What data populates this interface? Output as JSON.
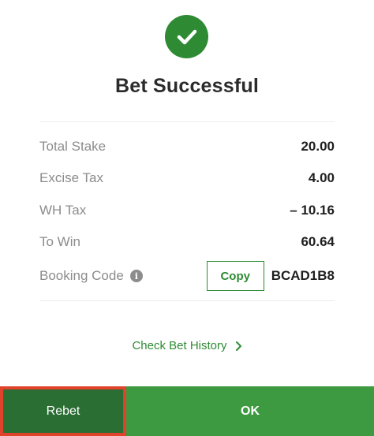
{
  "header": {
    "title": "Bet Successful",
    "icon": "checkmark-circle-icon"
  },
  "summary": {
    "total_stake_label": "Total Stake",
    "total_stake_value": "20.00",
    "excise_tax_label": "Excise Tax",
    "excise_tax_value": "4.00",
    "wh_tax_label": "WH Tax",
    "wh_tax_value": "– 10.16",
    "to_win_label": "To Win",
    "to_win_value": "60.64",
    "booking_code_label": "Booking Code",
    "booking_code_value": "BCAD1B8",
    "copy_label": "Copy",
    "info_icon": "info-icon"
  },
  "links": {
    "check_history_label": "Check Bet History",
    "chevron_icon": "chevron-right-icon"
  },
  "footer": {
    "rebet_label": "Rebet",
    "ok_label": "OK"
  },
  "colors": {
    "brand_green": "#2e8b33",
    "ok_green": "#3d9a41",
    "rebet_green": "#2a6e33",
    "highlight_red": "#e0432b"
  }
}
